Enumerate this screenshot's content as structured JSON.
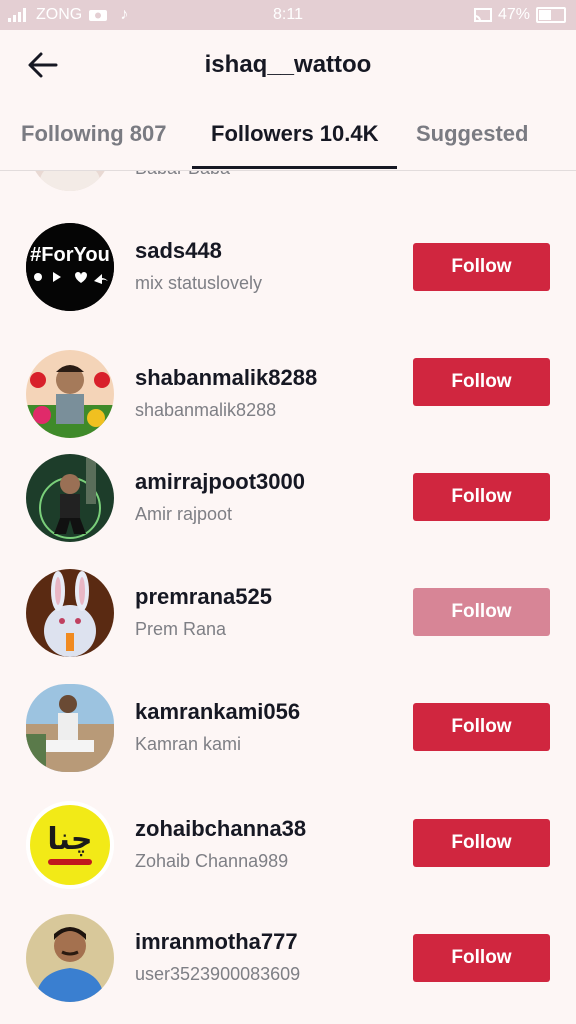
{
  "status_bar": {
    "carrier": "ZONG",
    "time": "8:11",
    "battery": "47%",
    "battery_level": 0.47
  },
  "header": {
    "back_icon": "arrow-left-icon",
    "title": "ishaq__wattoo"
  },
  "tabs": [
    {
      "label": "Following 807",
      "active": false
    },
    {
      "label": "Followers 10.4K",
      "active": true
    },
    {
      "label": "Suggested",
      "active": false
    }
  ],
  "partial_item": {
    "nickname": "Babar Baba"
  },
  "followers": [
    {
      "username": "sads448",
      "nickname": "mix statuslovely",
      "button": "Follow",
      "avatar_text": "#ForYou",
      "pressed": false
    },
    {
      "username": "shabanmalik8288",
      "nickname": "shabanmalik8288",
      "button": "Follow",
      "pressed": false
    },
    {
      "username": "amirrajpoot3000",
      "nickname": "Amir rajpoot",
      "button": "Follow",
      "pressed": false
    },
    {
      "username": "premrana525",
      "nickname": "Prem Rana",
      "button": "Follow",
      "pressed": true
    },
    {
      "username": "kamrankami056",
      "nickname": "Kamran kami",
      "button": "Follow",
      "pressed": false
    },
    {
      "username": "zohaibchanna38",
      "nickname": "Zohaib Channa989",
      "button": "Follow",
      "avatar_text": "چنا",
      "pressed": false
    },
    {
      "username": "imranmotha777",
      "nickname": "user3523900083609",
      "button": "Follow",
      "pressed": false
    }
  ],
  "colors": {
    "follow_button": "#d0263f",
    "follow_button_pressed": "#d78596",
    "status_bar": "#e4cfd3"
  }
}
